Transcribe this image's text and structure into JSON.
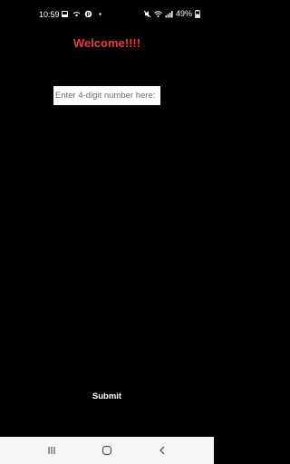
{
  "status_bar": {
    "time": "10:59",
    "battery_percent": "49%",
    "left_icons": [
      "gallery-icon",
      "wifi-calling-icon",
      "pinterest-icon",
      "dot-icon"
    ],
    "right_icons": [
      "mute-icon",
      "wifi-icon",
      "signal-icon",
      "battery-icon"
    ]
  },
  "main": {
    "title": "Welcome!!!!",
    "title_color": "#e23c3c",
    "pin_input": {
      "value": "",
      "placeholder": "Enter 4-digit number here:"
    },
    "submit_label": "Submit"
  },
  "nav_bar": {
    "buttons": [
      "recent-apps-icon",
      "home-icon",
      "back-icon"
    ]
  }
}
